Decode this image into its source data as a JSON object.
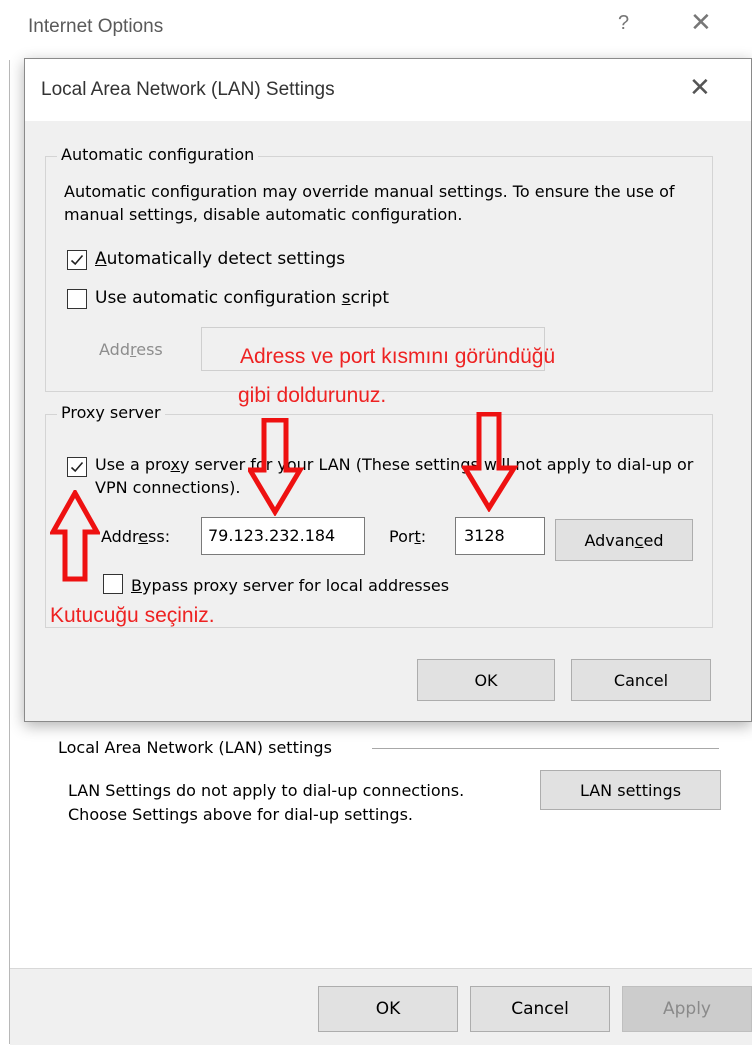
{
  "outer": {
    "title": "Internet Options",
    "help_glyph": "?",
    "close_glyph": "✕",
    "lan_section_title": "Local Area Network (LAN) settings",
    "lan_section_desc": "LAN Settings do not apply to dial-up connections. Choose Settings above for dial-up settings.",
    "lan_settings_button": "LAN settings",
    "ok_button": "OK",
    "cancel_button": "Cancel",
    "apply_button": "Apply"
  },
  "dialog": {
    "title": "Local Area Network (LAN) Settings",
    "close_glyph": "✕",
    "automatic": {
      "group_title": "Automatic configuration",
      "description": "Automatic configuration may override manual settings.  To ensure the use of manual settings, disable automatic configuration.",
      "auto_detect": {
        "label_pre": "",
        "label_key": "A",
        "label_post": "utomatically detect settings",
        "checked": true
      },
      "auto_script": {
        "label_pre": "Use automatic configuration ",
        "label_key": "s",
        "label_post": "cript",
        "checked": false
      },
      "address_label_pre": "Add",
      "address_label_key": "r",
      "address_label_post": "ess",
      "address_value": ""
    },
    "proxy": {
      "group_title": "Proxy server",
      "use_proxy": {
        "label_pre": "Use a pro",
        "label_key": "x",
        "label_post": "y server for your LAN (These settings will not apply to dial-up or VPN connections).",
        "checked": true
      },
      "address_label_pre": "Addr",
      "address_label_key": "e",
      "address_label_post": "ss:",
      "address_value": "79.123.232.184",
      "port_label_pre": "Por",
      "port_label_key": "t",
      "port_label_post": ":",
      "port_value": "3128",
      "advanced_pre": "Advan",
      "advanced_key": "c",
      "advanced_post": "ed",
      "bypass": {
        "label_pre": "",
        "label_key": "B",
        "label_post": "ypass proxy server for local addresses",
        "checked": false
      }
    },
    "ok_button": "OK",
    "cancel_button": "Cancel"
  },
  "annotations": {
    "line1": "Adress ve port kısmını göründüğü",
    "line2": "gibi doldurunuz.",
    "checkbox_hint": "Kutucuğu seçiniz.",
    "color": "#ee2222"
  },
  "icons": [
    "help-icon",
    "close-icon",
    "checkmark-icon",
    "red-arrow-down-icon",
    "red-arrow-up-icon"
  ]
}
